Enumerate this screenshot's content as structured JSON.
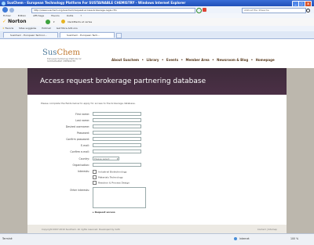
{
  "window": {
    "title": "SusChem - European Technology Platform For SUSTAINABLE CHEMISTRY - Windows Internet Explorer",
    "minimize": "_",
    "maximize": "□",
    "close": "x"
  },
  "address_bar": {
    "url": "http://www.suschem.org/suschem/request-access-brokerage-regis.cfm",
    "search_placeholder": "ASP.net file: Rheache"
  },
  "menu": [
    "Fichier",
    "Edition",
    "Affichage",
    "Favoris",
    "Outils",
    "?"
  ],
  "norton": {
    "brand": "Norton",
    "search_label": "Identifiants et cartes"
  },
  "favorites_bar": {
    "favoris": "Favoris",
    "items": [
      "Sites suggérés",
      "Hotmail",
      "Get More Add-ons"
    ]
  },
  "tabs": [
    {
      "label": "SusChem - European Technol..."
    },
    {
      "label": "SusChem - European Tech..."
    }
  ],
  "site": {
    "logo_part1": "Sus",
    "logo_part2": "Chem",
    "logo_sub": "European Technology Platform for SUSTAINABLE CHEMISTRY",
    "nav": [
      "About Suschem",
      "Library",
      "Events",
      "Member Area",
      "Newsroom & Blog",
      "Homepage"
    ],
    "nav_separator": "•",
    "banner_title": "Access request brokerage partnering database",
    "intro": "Please complete the fields below to apply for access to the brokerage database.",
    "fields": [
      {
        "label": "First name:"
      },
      {
        "label": "Last name:"
      },
      {
        "label": "Desired username:"
      },
      {
        "label": "Password:"
      },
      {
        "label": "Confirm password:"
      },
      {
        "label": "E-mail:"
      },
      {
        "label": "Confirm e-mail:"
      }
    ],
    "country_label": "Country:",
    "country_value": "Please select",
    "organisation_label": "Organisation:",
    "interests_label": "Interests:",
    "interests": [
      "Industrial Biotechnology",
      "Materials Technology",
      "Reaction & Process Design"
    ],
    "other_interests_label": "Other interests:",
    "request_button": "Request access",
    "footer_copy": "Copyright 2007-2010 SusChem. All rights reserved. Developed by Cefic",
    "footer_links": "Contact | Sitemap"
  },
  "status": {
    "text": "Terminé",
    "zone": "Internet",
    "zoom": "100 %"
  }
}
